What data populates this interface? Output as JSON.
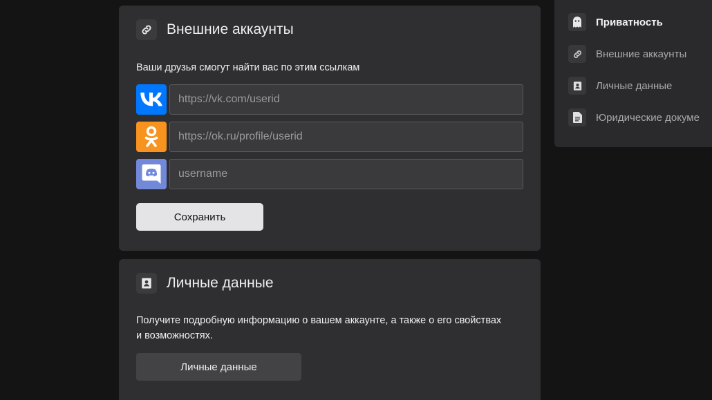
{
  "external_accounts": {
    "title": "Внешние аккаунты",
    "icon": "link-icon",
    "description": "Ваши друзья смогут найти вас по этим ссылкам",
    "links": [
      {
        "service": "vk",
        "icon": "vk-logo-icon",
        "color": "#0077ff",
        "placeholder": "https://vk.com/userid",
        "value": ""
      },
      {
        "service": "ok",
        "icon": "odnoklassniki-logo-icon",
        "color": "#f7931e",
        "placeholder": "https://ok.ru/profile/userid",
        "value": ""
      },
      {
        "service": "discord",
        "icon": "discord-logo-icon",
        "color": "#7289da",
        "placeholder": "username",
        "value": ""
      }
    ],
    "save_label": "Сохранить"
  },
  "personal_data": {
    "title": "Личные данные",
    "icon": "contact-card-icon",
    "description_line1": "Получите подробную информацию о вашем аккаунте, а также о его свойствах",
    "description_line2": "и возможностях.",
    "button_label": "Личные данные"
  },
  "side_nav": {
    "items": [
      {
        "label": "Приватность",
        "icon": "ghost-icon",
        "active": true
      },
      {
        "label": "Внешние аккаунты",
        "icon": "link-icon",
        "active": false
      },
      {
        "label": "Личные данные",
        "icon": "contact-card-icon",
        "active": false
      },
      {
        "label": "Юридические докуме",
        "icon": "document-icon",
        "active": false
      }
    ]
  }
}
